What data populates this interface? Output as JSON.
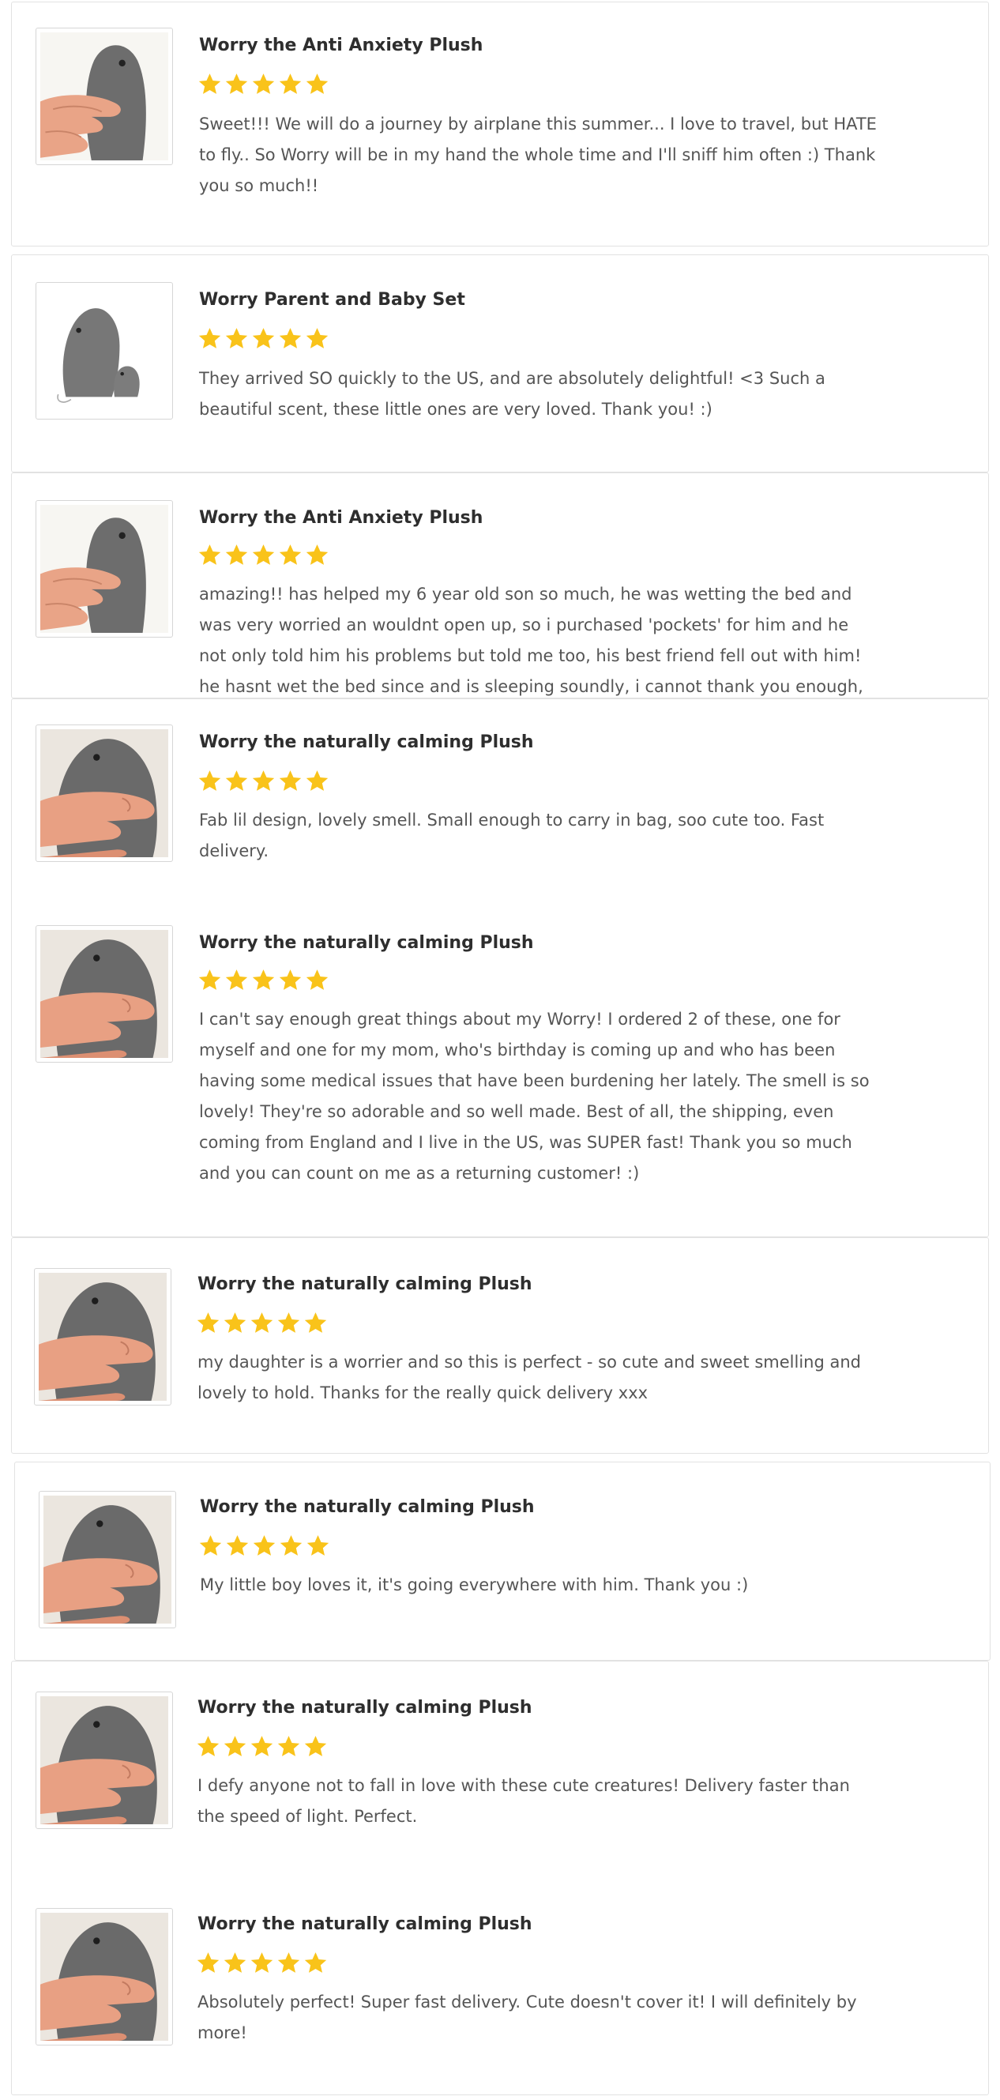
{
  "colors": {
    "star": "#f9c31a",
    "title": "#2e2e2e",
    "text": "#555555",
    "border": "#e2e2e2"
  },
  "icons": {
    "star": "star-icon"
  },
  "reviews": [
    {
      "product": "Worry the Anti Anxiety Plush",
      "rating": 5,
      "text": "Sweet!!! We will do a journey by airplane this summer... I love to travel, but HATE\nto fly.. So Worry will be in my hand the whole time and I'll sniff him often :) Thank\nyou so much!!"
    },
    {
      "product": "Worry Parent and Baby Set",
      "rating": 5,
      "text": "They arrived SO quickly to the US, and are absolutely delightful! <3 Such a\nbeautiful scent, these little ones are very loved. Thank you! :)"
    },
    {
      "product": "Worry the Anti Anxiety Plush",
      "rating": 5,
      "text": "amazing!! has helped my 6 year old son so much, he was wetting the bed and\nwas very worried an wouldnt open up, so i purchased 'pockets' for him and he\nnot only told him his problems but told me too, his best friend fell out with him!\nhe hasnt wet the bed since and is sleeping soundly, i cannot thank you enough,"
    },
    {
      "product": "Worry the naturally calming Plush",
      "rating": 5,
      "text": "Fab lil design, lovely smell. Small enough to carry in bag, soo cute too. Fast\ndelivery."
    },
    {
      "product": "Worry the naturally calming Plush",
      "rating": 5,
      "text": "I can't say enough great things about my Worry! I ordered 2 of these, one for\nmyself and one for my mom, who's birthday is coming up and who has been\nhaving some medical issues that have been burdening her lately. The smell is so\nlovely! They're so adorable and so well made. Best of all, the shipping, even\ncoming from England and I live in the US, was SUPER fast! Thank you so much\nand you can count on me as a returning customer! :)"
    },
    {
      "product": "Worry the naturally calming Plush",
      "rating": 5,
      "text": "my daughter is a worrier and so this is perfect - so cute and sweet smelling and\nlovely to hold. Thanks for the really quick delivery xxx"
    },
    {
      "product": "Worry the naturally calming Plush",
      "rating": 5,
      "text": "My little boy loves it, it's going everywhere with him. Thank you :)"
    },
    {
      "product": "Worry the naturally calming Plush",
      "rating": 5,
      "text": "I defy anyone not to fall in love with these cute creatures! Delivery faster than\nthe speed of light. Perfect."
    },
    {
      "product": "Worry the naturally calming Plush",
      "rating": 5,
      "text": "Absolutely perfect! Super fast delivery. Cute doesn't cover it! I will definitely by\nmore!"
    }
  ]
}
